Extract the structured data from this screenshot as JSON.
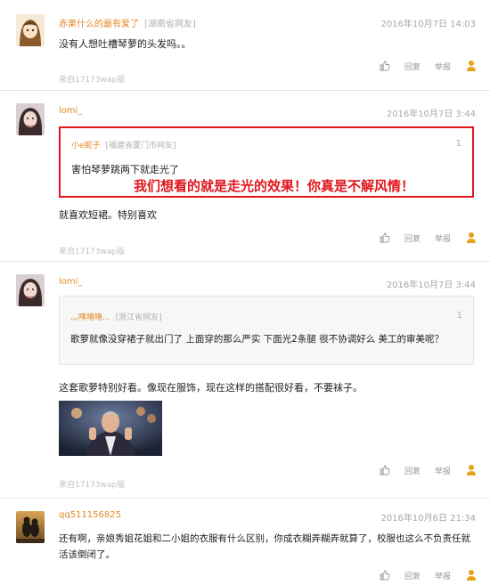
{
  "actions": {
    "reply": "回复",
    "report": "举报"
  },
  "comments": [
    {
      "user": "赤果什么的最有爱了",
      "location": "[湖南省网友]",
      "time": "2016年10月7日 14:03",
      "text": "没有人想吐槽琴萝的头发吗。。",
      "source": "来自17173wap版"
    },
    {
      "user": "lomi_",
      "location": "",
      "time": "2016年10月7日 3:44",
      "quote": {
        "user": "小e妮子",
        "location": "[福建省厦门市网友]",
        "num": "1",
        "text": "害怕琴萝跳两下就走光了"
      },
      "overlay": "我们想看的就是走光的效果！你真是不解风情！",
      "text": "就喜欢短裙。特别喜欢",
      "source": "来自17173wap版"
    },
    {
      "user": "lomi_",
      "location": "",
      "time": "2016年10月7日 3:44",
      "quote": {
        "user": "灬咦嘻嘻...",
        "location": "[浙江省网友]",
        "num": "1",
        "text": "歌萝就像没穿裙子就出门了 上面穿的那么严实 下面光2条腿 很不协调好么 美工的审美呢？"
      },
      "text": "这套歌萝特别好看。像现在服饰，现在这样的搭配很好看，不要袜子。",
      "source": "来自17173wap版"
    },
    {
      "user": "qq511156825",
      "location": "",
      "time": "2016年10月6日 21:34",
      "text_line1": "还有啊，亲娘秀姐花姐和二小姐的衣服有什么区别，你成衣糊弄糊弄就算了，校服也这么不负责任就",
      "text_line2": "活该倒闭了。"
    }
  ],
  "colors": {
    "username": "#e28a26",
    "highlight": "#e0161c",
    "report_icon": "#e8a21a"
  }
}
